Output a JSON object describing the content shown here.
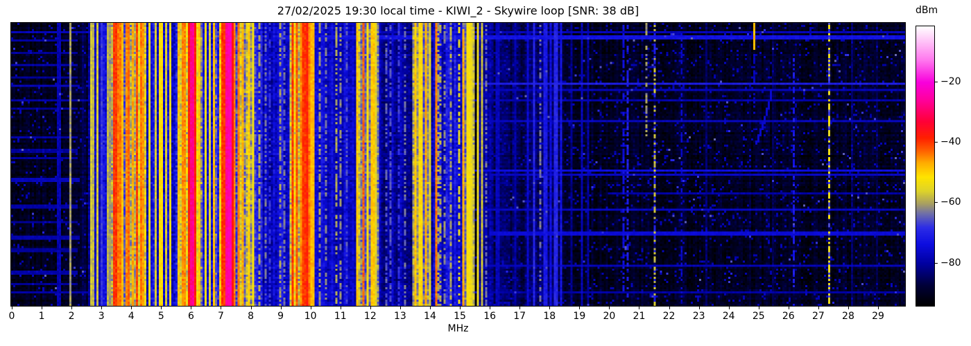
{
  "figure": {
    "title": "27/02/2025 19:30 local time - KIWI_2 - Skywire loop [SNR: 38 dB]",
    "xlabel": "MHz",
    "colorbar_label": "dBm"
  },
  "chart_data": {
    "type": "heatmap",
    "title": "27/02/2025 19:30 local time - KIWI_2 - Skywire loop [SNR: 38 dB]",
    "xlabel": "MHz",
    "x_range": [
      0,
      29.95
    ],
    "x_ticks": [
      0,
      1,
      2,
      3,
      4,
      5,
      6,
      7,
      8,
      9,
      10,
      11,
      12,
      13,
      14,
      15,
      16,
      17,
      18,
      19,
      20,
      21,
      22,
      23,
      24,
      25,
      26,
      27,
      28,
      29
    ],
    "y_ticks": [],
    "colorbar": {
      "label": "dBm",
      "ticks": [
        -20,
        -40,
        -60,
        -80
      ],
      "level_range_dbm": [
        -94.3,
        -1.4
      ]
    },
    "colormap_stops": [
      [
        0.0,
        "#000000"
      ],
      [
        0.07,
        "#000036"
      ],
      [
        0.15,
        "#0000a0"
      ],
      [
        0.22,
        "#0d0de0"
      ],
      [
        0.28,
        "#2d2de6"
      ],
      [
        0.33,
        "#7070a8"
      ],
      [
        0.365,
        "#a89f62"
      ],
      [
        0.41,
        "#ded32a"
      ],
      [
        0.46,
        "#ffe400"
      ],
      [
        0.51,
        "#ffae00"
      ],
      [
        0.555,
        "#ff6000"
      ],
      [
        0.6,
        "#ff2000"
      ],
      [
        0.66,
        "#ff0038"
      ],
      [
        0.74,
        "#ff00a0"
      ],
      [
        0.8,
        "#f800dc"
      ],
      [
        0.88,
        "#ff78ee"
      ],
      [
        1.0,
        "#ffffff"
      ]
    ],
    "grid": {
      "cols": 430,
      "rows": 137,
      "seed": 20250227
    },
    "bands": [
      [
        0.0,
        1.95,
        -91,
        2.5
      ],
      [
        1.95,
        2.55,
        -88,
        3
      ],
      [
        2.55,
        3.35,
        -77,
        6
      ],
      [
        3.35,
        4.55,
        -61,
        7
      ],
      [
        4.55,
        5.55,
        -73,
        8
      ],
      [
        5.55,
        6.35,
        -57,
        8
      ],
      [
        6.35,
        6.95,
        -68,
        8
      ],
      [
        6.95,
        7.55,
        -53,
        8
      ],
      [
        7.55,
        8.25,
        -62,
        8
      ],
      [
        8.25,
        9.35,
        -75,
        6
      ],
      [
        9.35,
        10.12,
        -56,
        8
      ],
      [
        10.12,
        11.55,
        -76,
        5
      ],
      [
        11.55,
        12.3,
        -62,
        7
      ],
      [
        12.3,
        13.45,
        -80,
        5
      ],
      [
        13.45,
        14.1,
        -63,
        7
      ],
      [
        14.1,
        15.1,
        -74,
        7
      ],
      [
        15.1,
        15.53,
        -60,
        6
      ],
      [
        15.53,
        15.6,
        -93,
        2
      ],
      [
        15.6,
        16.15,
        -79,
        5
      ],
      [
        16.15,
        18.5,
        -85,
        4
      ],
      [
        18.5,
        29.95,
        -90,
        3
      ]
    ],
    "carriers": [
      [
        1.6,
        -79
      ],
      [
        1.98,
        -61
      ],
      [
        2.65,
        -57
      ],
      [
        2.78,
        -59
      ],
      [
        2.9,
        -57
      ],
      [
        3.05,
        -68
      ],
      [
        3.22,
        -59
      ],
      [
        3.3,
        -61
      ],
      [
        3.5,
        -40,
        0.1
      ],
      [
        3.62,
        -44
      ],
      [
        3.73,
        -48
      ],
      [
        3.88,
        -45
      ],
      [
        3.95,
        -43
      ],
      [
        4.1,
        -47
      ],
      [
        4.22,
        -41,
        0.1
      ],
      [
        4.33,
        -44
      ],
      [
        4.45,
        -46
      ],
      [
        4.65,
        -54
      ],
      [
        4.85,
        -57
      ],
      [
        5.0,
        -51,
        0.1
      ],
      [
        5.2,
        -57
      ],
      [
        5.35,
        -55
      ],
      [
        5.62,
        -49
      ],
      [
        5.78,
        -45,
        0.08
      ],
      [
        5.95,
        -38,
        0.08
      ],
      [
        6.05,
        -27,
        0.1
      ],
      [
        6.15,
        -38,
        0.08
      ],
      [
        6.28,
        -49
      ],
      [
        6.5,
        -53
      ],
      [
        6.65,
        -56
      ],
      [
        6.8,
        -48
      ],
      [
        7.1,
        -40,
        0.08
      ],
      [
        7.22,
        -26,
        0.1
      ],
      [
        7.32,
        -24,
        0.1
      ],
      [
        7.42,
        -36,
        0.08
      ],
      [
        7.5,
        -44
      ],
      [
        7.65,
        -44
      ],
      [
        7.78,
        -47
      ],
      [
        7.95,
        -50
      ],
      [
        8.1,
        -53
      ],
      [
        8.35,
        -60,
        0.07,
        1
      ],
      [
        8.5,
        -64,
        0.07,
        1
      ],
      [
        8.7,
        -68,
        0.07,
        1
      ],
      [
        9.0,
        -61,
        0.07,
        1
      ],
      [
        9.15,
        -64,
        0.07,
        1
      ],
      [
        9.45,
        -40,
        0.08
      ],
      [
        9.57,
        -42
      ],
      [
        9.7,
        -45
      ],
      [
        9.82,
        -40,
        0.08
      ],
      [
        9.93,
        -38,
        0.08
      ],
      [
        10.02,
        -44
      ],
      [
        10.1,
        -48
      ],
      [
        10.35,
        -61,
        0.07,
        1
      ],
      [
        10.55,
        -63,
        0.07,
        1
      ],
      [
        10.9,
        -60,
        0.07,
        1
      ],
      [
        11.05,
        -62,
        0.07,
        1
      ],
      [
        11.25,
        -66,
        0.07,
        1
      ],
      [
        11.62,
        -49
      ],
      [
        11.78,
        -43,
        0.08
      ],
      [
        11.95,
        -51
      ],
      [
        12.12,
        -49
      ],
      [
        12.25,
        -56
      ],
      [
        12.55,
        -65,
        0.07,
        1
      ],
      [
        12.7,
        -66,
        0.07,
        1
      ],
      [
        13.0,
        -68,
        0.07,
        1
      ],
      [
        13.2,
        -64,
        0.07,
        1
      ],
      [
        13.55,
        -49
      ],
      [
        13.72,
        -51
      ],
      [
        13.9,
        -47,
        0.08
      ],
      [
        14.02,
        -56
      ],
      [
        14.25,
        -44
      ],
      [
        14.35,
        -60,
        0.07,
        1
      ],
      [
        14.5,
        -62,
        0.07,
        1
      ],
      [
        14.75,
        -60,
        0.07,
        1
      ],
      [
        15.0,
        -56,
        0.07,
        1
      ],
      [
        15.15,
        -47,
        0.08,
        0,
        0.015,
        1
      ],
      [
        15.33,
        -52,
        0.1
      ],
      [
        15.45,
        -55
      ],
      [
        15.65,
        -55
      ],
      [
        15.75,
        -58
      ],
      [
        15.9,
        -64,
        0.07,
        1
      ],
      [
        16.3,
        -78
      ],
      [
        16.9,
        -80
      ],
      [
        17.3,
        -76
      ],
      [
        17.55,
        -70
      ],
      [
        17.75,
        -63,
        0.07,
        2
      ],
      [
        17.9,
        -72
      ],
      [
        18.1,
        -74
      ],
      [
        18.25,
        -70
      ],
      [
        18.4,
        -73
      ],
      [
        18.8,
        -82
      ],
      [
        19.15,
        -78
      ],
      [
        19.3,
        -80
      ],
      [
        20.5,
        -74,
        0.07,
        1
      ],
      [
        20.68,
        -71,
        0.07,
        1
      ],
      [
        21.3,
        -61,
        0.07,
        1,
        0,
        0.4
      ],
      [
        21.55,
        -58,
        0.07,
        2
      ],
      [
        22.45,
        -76,
        0.07,
        1
      ],
      [
        23.3,
        -84
      ],
      [
        24.9,
        -48,
        0.07,
        0,
        0,
        0.09
      ],
      [
        24.9,
        -78,
        0.07,
        1,
        0.09,
        0.32
      ],
      [
        25.5,
        -86
      ],
      [
        26.2,
        -72,
        0.07,
        1,
        0.12,
        1
      ],
      [
        27.4,
        -54,
        0.08,
        2
      ],
      [
        28.2,
        -84
      ],
      [
        29.0,
        -86
      ]
    ],
    "h_lines": [
      [
        0.028,
        0,
        30,
        -78
      ],
      [
        0.047,
        9,
        30,
        -73
      ],
      [
        0.06,
        0,
        2.2,
        -80
      ],
      [
        0.1,
        0,
        2.2,
        -81
      ],
      [
        0.145,
        0,
        2.2,
        -79
      ],
      [
        0.19,
        0,
        2.2,
        -81
      ],
      [
        0.21,
        15.5,
        30,
        -71
      ],
      [
        0.218,
        0,
        2.3,
        -78
      ],
      [
        0.235,
        16,
        30,
        -78
      ],
      [
        0.27,
        0,
        30,
        -79
      ],
      [
        0.3,
        0,
        2.2,
        -81
      ],
      [
        0.345,
        15.5,
        30,
        -77
      ],
      [
        0.4,
        0,
        2.2,
        -80
      ],
      [
        0.45,
        0,
        2.2,
        -81
      ],
      [
        0.475,
        0,
        2.2,
        -80
      ],
      [
        0.52,
        15.5,
        30,
        -74
      ],
      [
        0.535,
        16,
        30,
        -77
      ],
      [
        0.55,
        0,
        2.3,
        -78
      ],
      [
        0.6,
        20,
        30,
        -80
      ],
      [
        0.645,
        0,
        2.2,
        -80
      ],
      [
        0.655,
        15.5,
        30,
        -77
      ],
      [
        0.7,
        0,
        2.2,
        -81
      ],
      [
        0.74,
        16,
        30,
        -75
      ],
      [
        0.755,
        0,
        2.3,
        -79
      ],
      [
        0.8,
        0,
        2.2,
        -81
      ],
      [
        0.855,
        14.5,
        30,
        -78
      ],
      [
        0.88,
        0,
        2.2,
        -80
      ],
      [
        0.92,
        0,
        2.2,
        -81
      ],
      [
        0.95,
        0,
        30,
        -80
      ]
    ],
    "drifter": {
      "f_start": 25.45,
      "f_end": 24.95,
      "row_start": 0.235,
      "row_end": 0.42,
      "level": -76
    }
  }
}
